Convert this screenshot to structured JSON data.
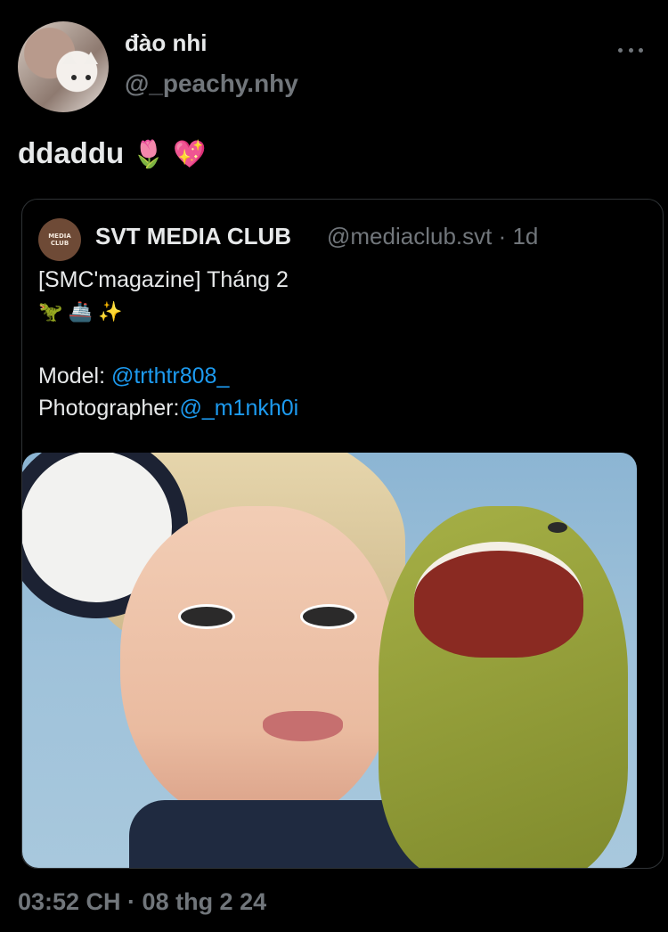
{
  "author": {
    "display_name": "đào nhi",
    "handle": "@_peachy.nhy"
  },
  "tweet": {
    "text": "ddaddu",
    "emojis": "🌷 💖"
  },
  "quoted_tweet": {
    "avatar_text_1": "MEDIA",
    "avatar_text_2": "CLUB",
    "display_name": "SVT MEDIA CLUB",
    "handle_time": "@mediaclub.svt · 1d",
    "title": "[SMC'magazine] Tháng 2",
    "emojis": "🦖 🚢 ✨",
    "model_label": "Model: ",
    "model_link": "@trthtr808_",
    "photographer_label": "Photographer:",
    "photographer_link": "@_m1nkh0i"
  },
  "timestamp": "03:52 CH · 08 thg 2 24",
  "icons": {
    "more": "more-options-icon"
  },
  "colors": {
    "background": "#000000",
    "primary_text": "#e7e9ea",
    "secondary_text": "#71767b",
    "link": "#1d9bf0",
    "border": "#2f3336"
  }
}
